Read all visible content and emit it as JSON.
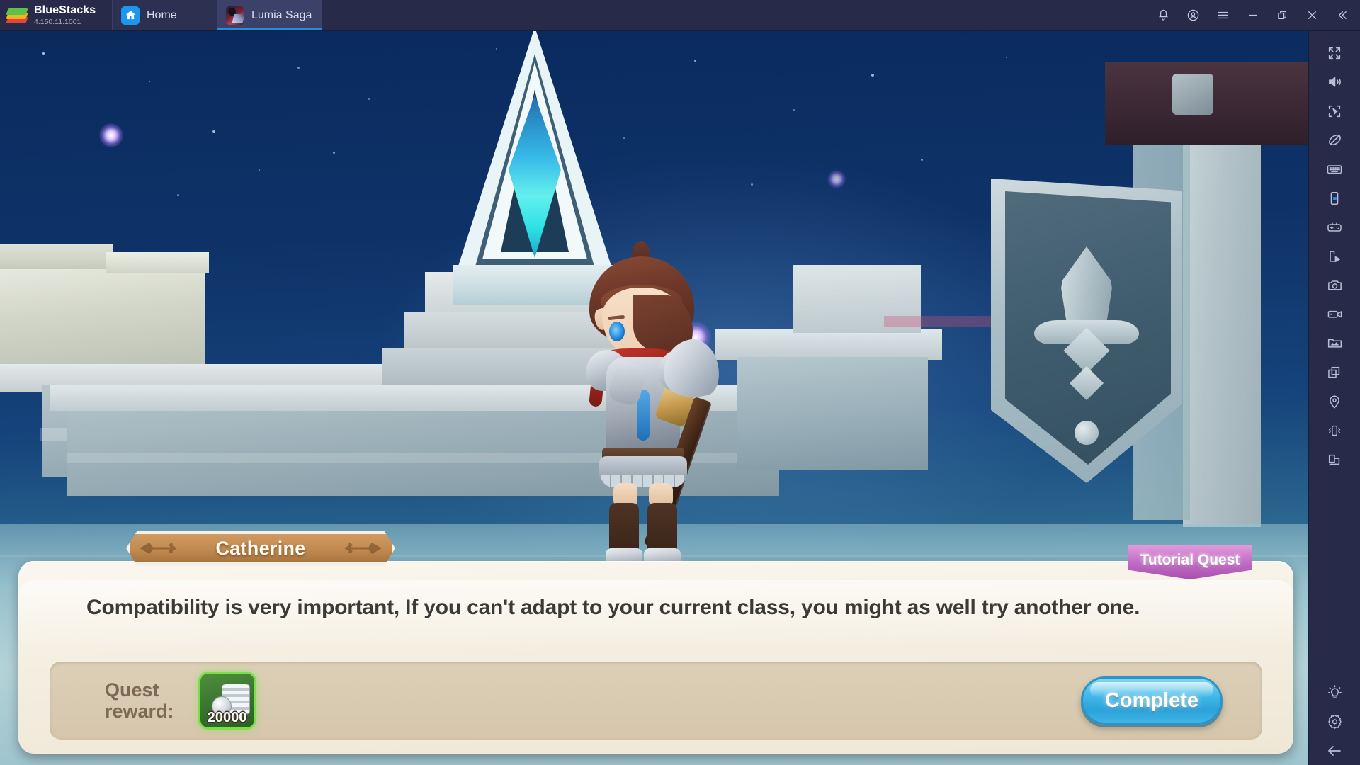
{
  "app": {
    "brand_name": "BlueStacks",
    "version": "4.150.11.1001"
  },
  "tabs": [
    {
      "label": "Home",
      "icon": "home-icon",
      "active": false
    },
    {
      "label": "Lumia Saga",
      "icon": "game-icon",
      "active": true
    }
  ],
  "window_controls": [
    {
      "name": "notifications-button",
      "icon": "bell-icon"
    },
    {
      "name": "account-button",
      "icon": "account-circle-icon"
    },
    {
      "name": "menu-button",
      "icon": "hamburger-icon"
    },
    {
      "name": "minimize-button",
      "icon": "minimize-icon"
    },
    {
      "name": "restore-button",
      "icon": "restore-icon"
    },
    {
      "name": "close-button",
      "icon": "close-icon"
    },
    {
      "name": "collapse-sidebar-button",
      "icon": "chevron-double-left-icon"
    }
  ],
  "toolbar": {
    "top_items": [
      {
        "name": "fullscreen-button",
        "icon": "fullscreen-icon"
      },
      {
        "name": "volume-button",
        "icon": "speaker-icon"
      },
      {
        "name": "multi-select-button",
        "icon": "cursor-frame-icon"
      },
      {
        "name": "eco-mode-button",
        "icon": "no-entry-slash-icon"
      },
      {
        "name": "keymapping-button",
        "icon": "keyboard-icon"
      },
      {
        "name": "rotate-screen-button",
        "icon": "phone-portrait-icon"
      },
      {
        "name": "gamepad-button",
        "icon": "gamepad-icon"
      },
      {
        "name": "macro-recorder-button",
        "icon": "script-play-icon"
      },
      {
        "name": "screenshot-button",
        "icon": "camera-icon"
      },
      {
        "name": "record-screen-button",
        "icon": "video-camera-icon"
      },
      {
        "name": "media-manager-button",
        "icon": "image-folder-icon"
      },
      {
        "name": "multi-instance-button",
        "icon": "copy-windows-icon"
      },
      {
        "name": "location-button",
        "icon": "map-pin-icon"
      },
      {
        "name": "shake-button",
        "icon": "shake-phone-icon"
      },
      {
        "name": "resize-button",
        "icon": "resize-window-icon"
      }
    ],
    "bottom_items": [
      {
        "name": "tips-button",
        "icon": "lightbulb-icon"
      },
      {
        "name": "settings-button",
        "icon": "gear-icon"
      },
      {
        "name": "back-button",
        "icon": "arrow-left-icon"
      }
    ]
  },
  "game": {
    "speaker_name": "Catherine",
    "quest_badge": "Tutorial Quest",
    "dialogue": "Compatibility is very important, If you can't adapt to your current class, you might as well try another one.",
    "reward_label": "Quest\nreward:",
    "reward_item": {
      "icon": "coin-stack-icon",
      "amount": "20000"
    },
    "complete_button": "Complete"
  },
  "colors": {
    "titlebar_bg": "#272b49",
    "tab_active_bg": "#3b4168",
    "tab_accent": "#1f8fe0",
    "dialog_bg": "#f5efe2",
    "reward_bg": "#d8c9af",
    "nameplate_bg": "#c08a50",
    "badge_bg": "#c06bc5",
    "complete_bg": "#41b8e8",
    "slot_green": "#3a7430",
    "crystal_cyan": "#4fe3e8"
  }
}
